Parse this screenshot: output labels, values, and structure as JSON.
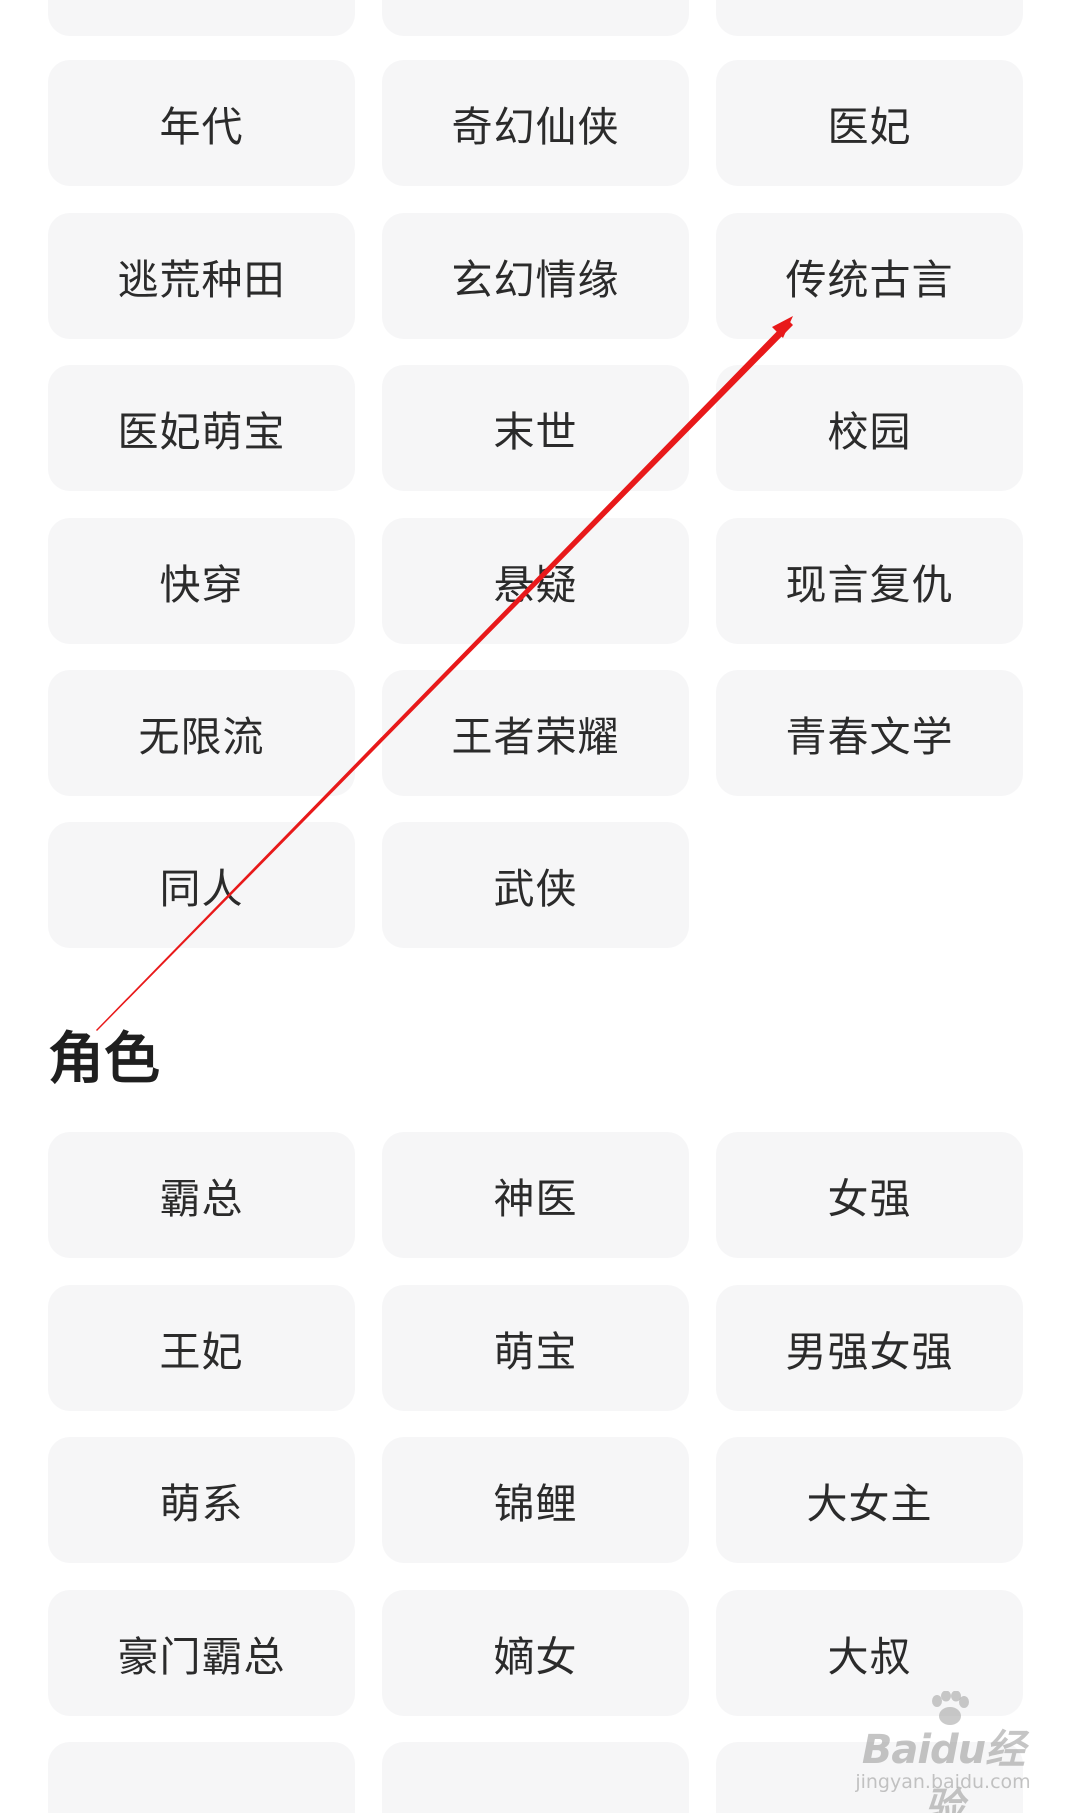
{
  "genre_tags": [
    "年代",
    "奇幻仙侠",
    "医妃",
    "逃荒种田",
    "玄幻情缘",
    "传统古言",
    "医妃萌宝",
    "末世",
    "校园",
    "快穿",
    "悬疑",
    "现言复仇",
    "无限流",
    "王者荣耀",
    "青春文学",
    "同人",
    "武侠"
  ],
  "role_section": {
    "title": "角色",
    "tags": [
      "霸总",
      "神医",
      "女强",
      "王妃",
      "萌宝",
      "男强女强",
      "萌系",
      "锦鲤",
      "大女主",
      "豪门霸总",
      "嫡女",
      "大叔"
    ]
  },
  "annotation": {
    "color": "#e8191a",
    "icon": "red-arrow"
  },
  "watermark": {
    "brand": "Baidu经验",
    "url": "jingyan.baidu.com"
  },
  "colors": {
    "tag_bg": "#f6f6f7",
    "tag_text": "#2b2b2b",
    "title_text": "#1f1f1f"
  }
}
